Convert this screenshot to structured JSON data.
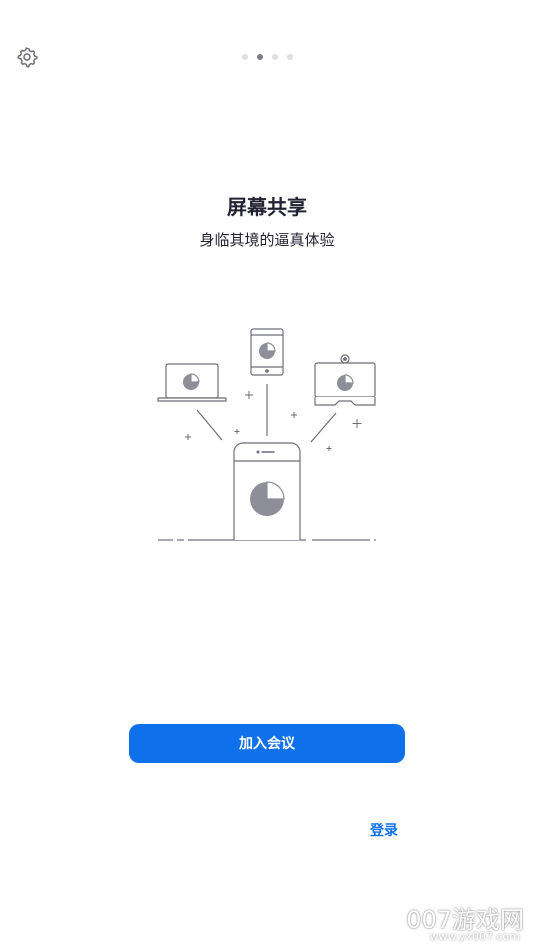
{
  "header": {
    "settings_icon": "gear-icon",
    "pager": {
      "total": 4,
      "active_index": 1
    }
  },
  "slide": {
    "title": "屏幕共享",
    "subtitle": "身临其境的逼真体验",
    "illustration": "screen-share-devices-illustration"
  },
  "actions": {
    "join_meeting_label": "加入会议",
    "sign_in_label": "登录"
  },
  "colors": {
    "accent": "#0e71eb",
    "text": "#232333",
    "pager_active": "#7b7b86",
    "pager_inactive": "#dedee3"
  },
  "watermark": {
    "brand": "007游戏网",
    "url": "www.yx007.com"
  }
}
